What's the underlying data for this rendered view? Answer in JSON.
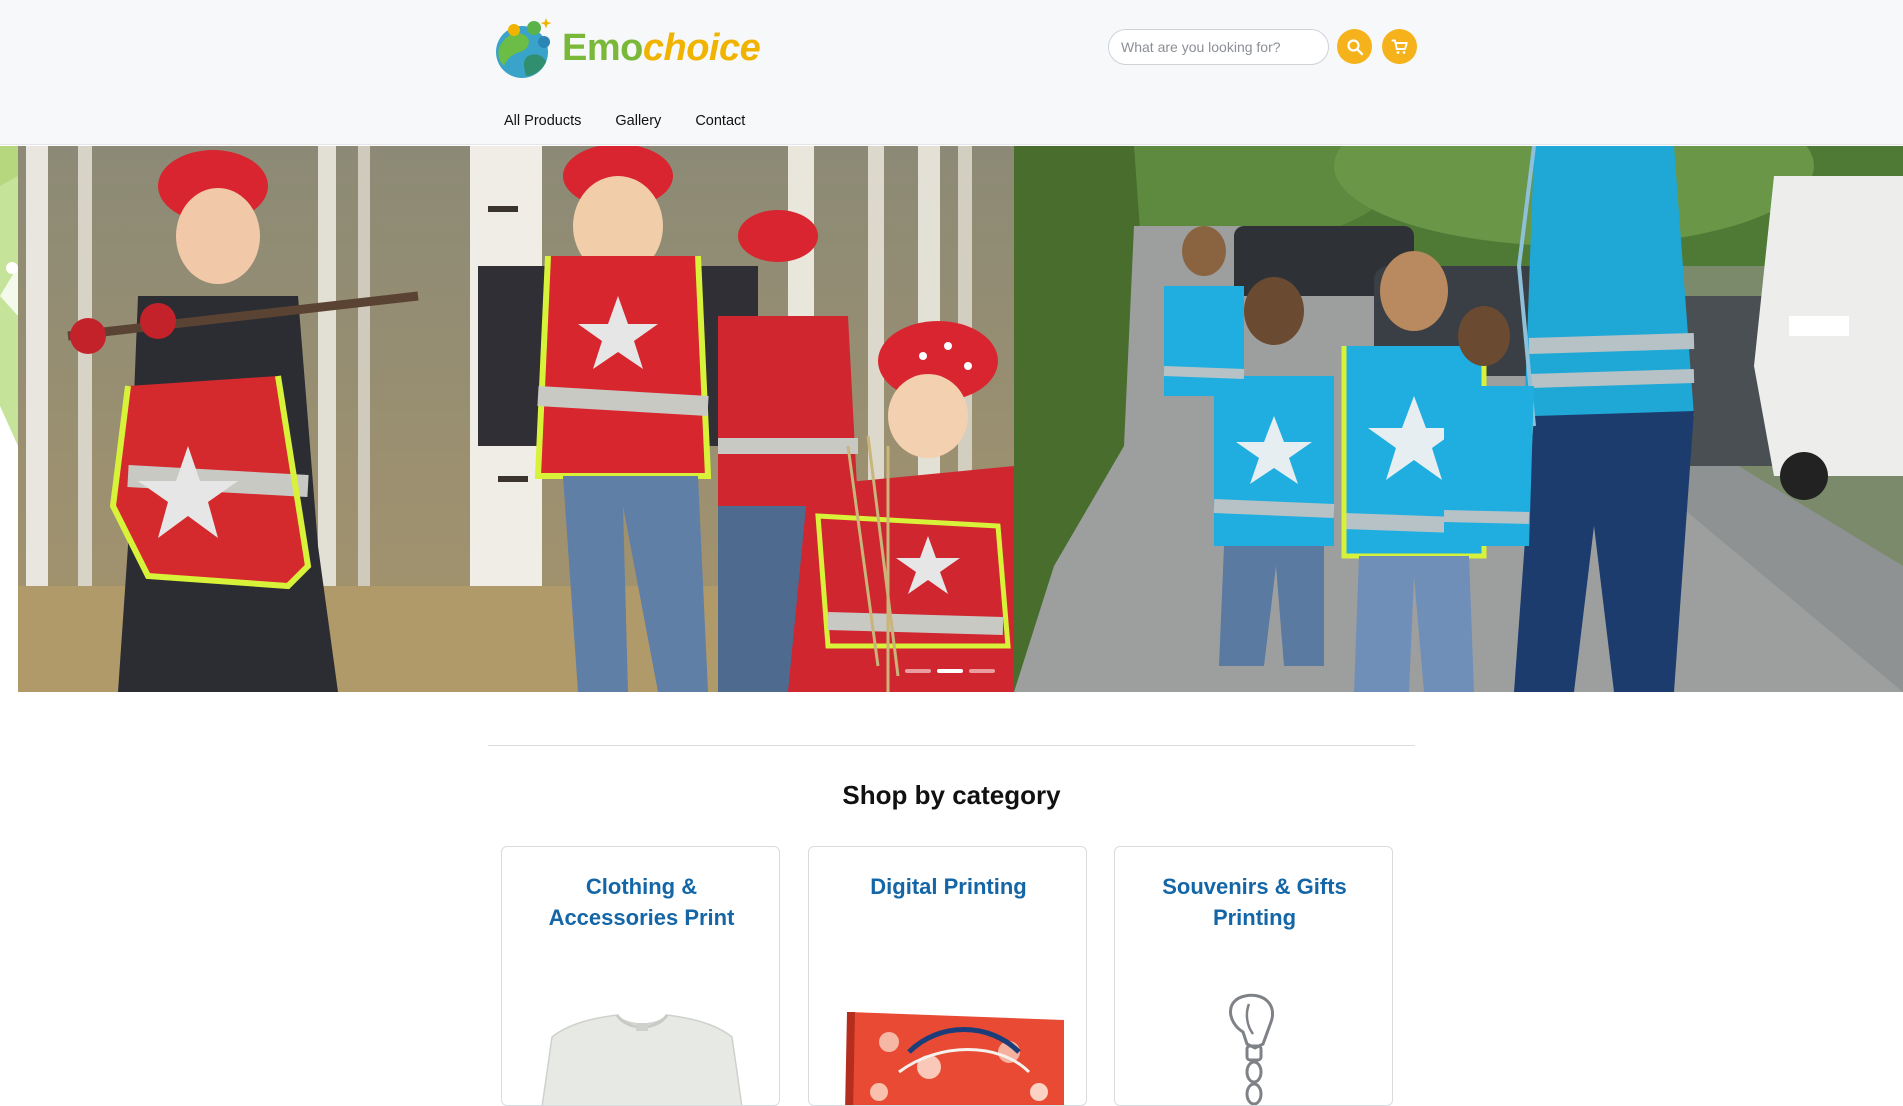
{
  "brand": {
    "name_part1": "Emo",
    "name_part2": "choice"
  },
  "search": {
    "placeholder": "What are you looking for?"
  },
  "icons": {
    "search": "search-icon",
    "cart": "cart-icon"
  },
  "nav": {
    "items": [
      "All Products",
      "Gallery",
      "Contact"
    ]
  },
  "hero": {
    "slides_count": 3,
    "active_slide": 2
  },
  "section": {
    "title": "Shop by category"
  },
  "categories": [
    {
      "title": "Clothing & Accessories Print"
    },
    {
      "title": "Digital Printing"
    },
    {
      "title": "Souvenirs & Gifts Printing"
    }
  ],
  "colors": {
    "accent": "#f5b21a",
    "link": "#1466a6",
    "logo_green": "#7ab83a",
    "logo_yellow": "#f0b400"
  }
}
